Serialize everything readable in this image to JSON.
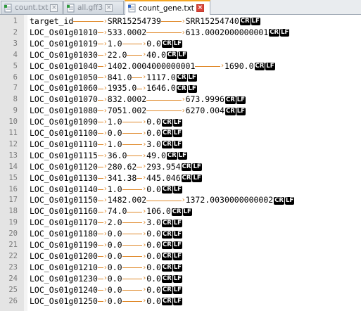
{
  "tabs": [
    {
      "title": "count.txt",
      "active": false
    },
    {
      "title": "all.gff3",
      "active": false
    },
    {
      "title": "count_gene.txt",
      "active": true
    }
  ],
  "eol": {
    "cr": "CR",
    "lf": "LF"
  },
  "lines": [
    {
      "n": "1",
      "cols": [
        "target_id",
        "SRR15254739",
        "SRR15254740"
      ]
    },
    {
      "n": "2",
      "cols": [
        "LOC_Os01g01010",
        "533.0002",
        "613.0002000000001"
      ]
    },
    {
      "n": "3",
      "cols": [
        "LOC_Os01g01019",
        "1.0",
        "0.0"
      ]
    },
    {
      "n": "4",
      "cols": [
        "LOC_Os01g01030",
        "22.0",
        "40.0"
      ]
    },
    {
      "n": "5",
      "cols": [
        "LOC_Os01g01040",
        "1402.0004000000001",
        "1690.0"
      ]
    },
    {
      "n": "6",
      "cols": [
        "LOC_Os01g01050",
        "841.0",
        "1117.0"
      ]
    },
    {
      "n": "7",
      "cols": [
        "LOC_Os01g01060",
        "1935.0",
        "1646.0"
      ]
    },
    {
      "n": "8",
      "cols": [
        "LOC_Os01g01070",
        "832.0002",
        "673.9996"
      ]
    },
    {
      "n": "9",
      "cols": [
        "LOC_Os01g01080",
        "7051.002",
        "6270.004"
      ]
    },
    {
      "n": "10",
      "cols": [
        "LOC_Os01g01090",
        "1.0",
        "0.0"
      ]
    },
    {
      "n": "11",
      "cols": [
        "LOC_Os01g01100",
        "0.0",
        "0.0"
      ]
    },
    {
      "n": "12",
      "cols": [
        "LOC_Os01g01110",
        "1.0",
        "3.0"
      ]
    },
    {
      "n": "13",
      "cols": [
        "LOC_Os01g01115",
        "36.0",
        "49.0"
      ]
    },
    {
      "n": "14",
      "cols": [
        "LOC_Os01g01120",
        "280.62",
        "293.954"
      ]
    },
    {
      "n": "15",
      "cols": [
        "LOC_Os01g01130",
        "341.38",
        "445.046"
      ]
    },
    {
      "n": "16",
      "cols": [
        "LOC_Os01g01140",
        "1.0",
        "0.0"
      ]
    },
    {
      "n": "17",
      "cols": [
        "LOC_Os01g01150",
        "1482.002",
        "1372.0030000000002"
      ]
    },
    {
      "n": "18",
      "cols": [
        "LOC_Os01g01160",
        "74.0",
        "106.0"
      ]
    },
    {
      "n": "19",
      "cols": [
        "LOC_Os01g01170",
        "2.0",
        "3.0"
      ]
    },
    {
      "n": "20",
      "cols": [
        "LOC_Os01g01180",
        "0.0",
        "0.0"
      ]
    },
    {
      "n": "21",
      "cols": [
        "LOC_Os01g01190",
        "0.0",
        "0.0"
      ]
    },
    {
      "n": "22",
      "cols": [
        "LOC_Os01g01200",
        "0.0",
        "0.0"
      ]
    },
    {
      "n": "23",
      "cols": [
        "LOC_Os01g01210",
        "0.0",
        "0.0"
      ]
    },
    {
      "n": "24",
      "cols": [
        "LOC_Os01g01230",
        "0.0",
        "0.0"
      ]
    },
    {
      "n": "25",
      "cols": [
        "LOC_Os01g01240",
        "0.0",
        "0.0"
      ]
    },
    {
      "n": "26",
      "cols": [
        "LOC_Os01g01250",
        "0.0",
        "0.0"
      ]
    }
  ]
}
